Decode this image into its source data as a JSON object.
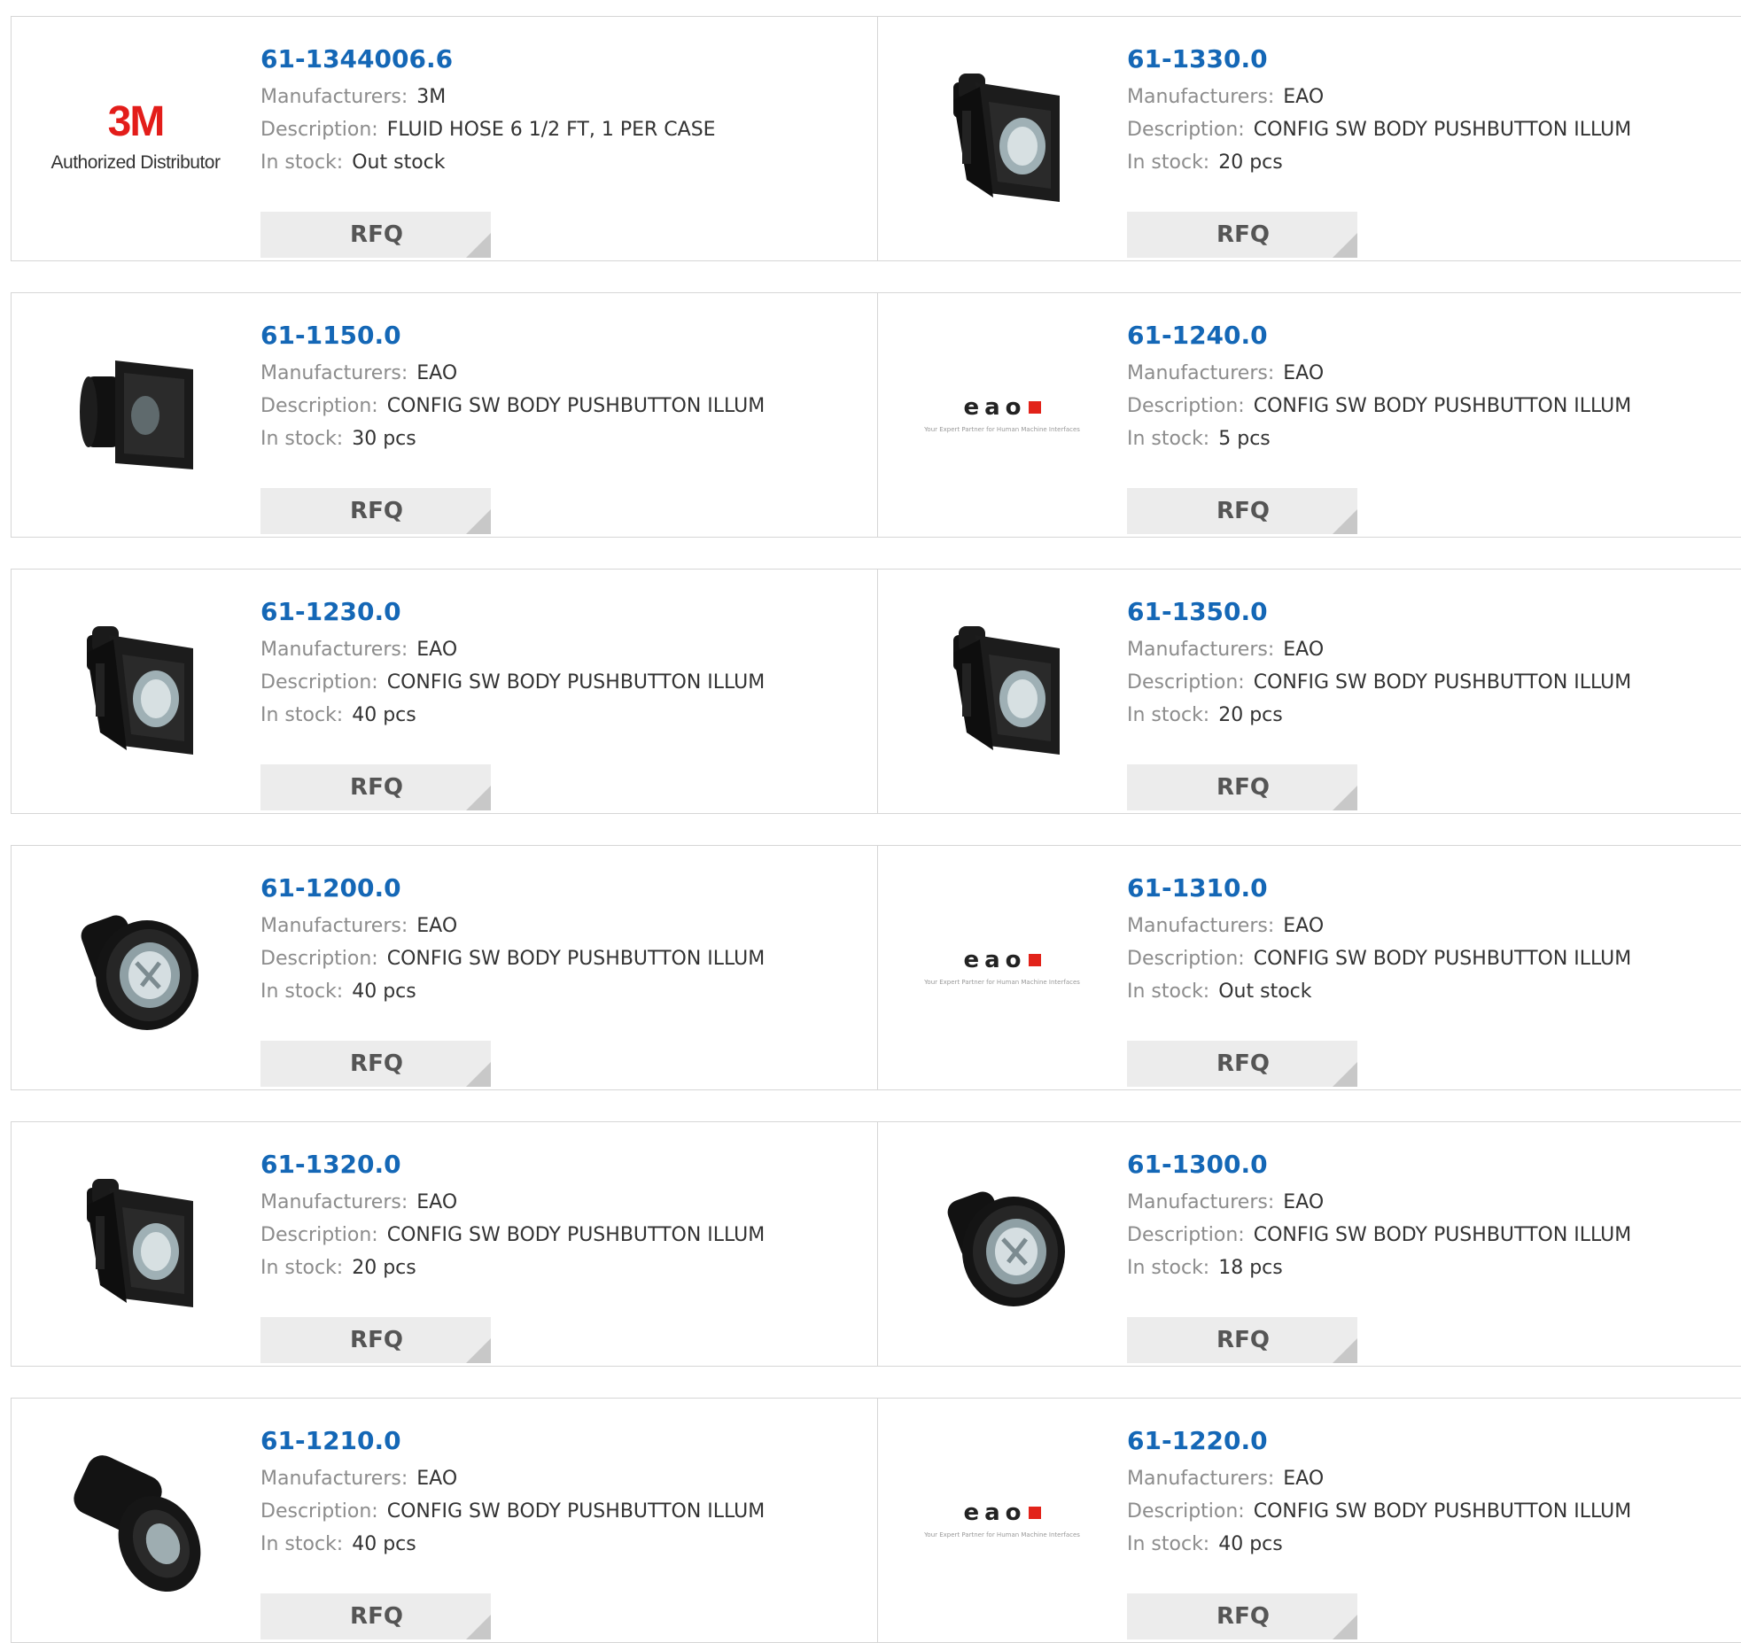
{
  "labels": {
    "manufacturers": "Manufacturers:",
    "description": "Description:",
    "in_stock": "In stock:",
    "rfq": "RFQ"
  },
  "logos": {
    "threem_mark": "3M",
    "threem_caption": "Authorized Distributor",
    "eao_word": "eao",
    "eao_tagline": "Your Expert Partner for Human Machine Interfaces"
  },
  "colors": {
    "link": "#1467b6",
    "brand_red": "#e31d1a",
    "button_bg": "#ececec"
  },
  "products": [
    {
      "part": "61-1344006.6",
      "manufacturer": "3M",
      "description": "FLUID HOSE 6 1/2 FT, 1 PER CASE",
      "stock": "Out stock",
      "image": "logo-3m"
    },
    {
      "part": "61-1330.0",
      "manufacturer": "EAO",
      "description": "CONFIG SW BODY PUSHBUTTON ILLUM",
      "stock": "20 pcs",
      "image": "square-pushbutton"
    },
    {
      "part": "61-1150.0",
      "manufacturer": "EAO",
      "description": "CONFIG SW BODY PUSHBUTTON ILLUM",
      "stock": "30 pcs",
      "image": "square-pushbutton-side"
    },
    {
      "part": "61-1240.0",
      "manufacturer": "EAO",
      "description": "CONFIG SW BODY PUSHBUTTON ILLUM",
      "stock": "5 pcs",
      "image": "logo-eao"
    },
    {
      "part": "61-1230.0",
      "manufacturer": "EAO",
      "description": "CONFIG SW BODY PUSHBUTTON ILLUM",
      "stock": "40 pcs",
      "image": "square-pushbutton"
    },
    {
      "part": "61-1350.0",
      "manufacturer": "EAO",
      "description": "CONFIG SW BODY PUSHBUTTON ILLUM",
      "stock": "20 pcs",
      "image": "square-pushbutton"
    },
    {
      "part": "61-1200.0",
      "manufacturer": "EAO",
      "description": "CONFIG SW BODY PUSHBUTTON ILLUM",
      "stock": "40 pcs",
      "image": "round-pushbutton"
    },
    {
      "part": "61-1310.0",
      "manufacturer": "EAO",
      "description": "CONFIG SW BODY PUSHBUTTON ILLUM",
      "stock": "Out stock",
      "image": "logo-eao"
    },
    {
      "part": "61-1320.0",
      "manufacturer": "EAO",
      "description": "CONFIG SW BODY PUSHBUTTON ILLUM",
      "stock": "20 pcs",
      "image": "square-pushbutton"
    },
    {
      "part": "61-1300.0",
      "manufacturer": "EAO",
      "description": "CONFIG SW BODY PUSHBUTTON ILLUM",
      "stock": "18 pcs",
      "image": "round-pushbutton"
    },
    {
      "part": "61-1210.0",
      "manufacturer": "EAO",
      "description": "CONFIG SW BODY PUSHBUTTON ILLUM",
      "stock": "40 pcs",
      "image": "round-pushbutton-side"
    },
    {
      "part": "61-1220.0",
      "manufacturer": "EAO",
      "description": "CONFIG SW BODY PUSHBUTTON ILLUM",
      "stock": "40 pcs",
      "image": "logo-eao"
    }
  ]
}
